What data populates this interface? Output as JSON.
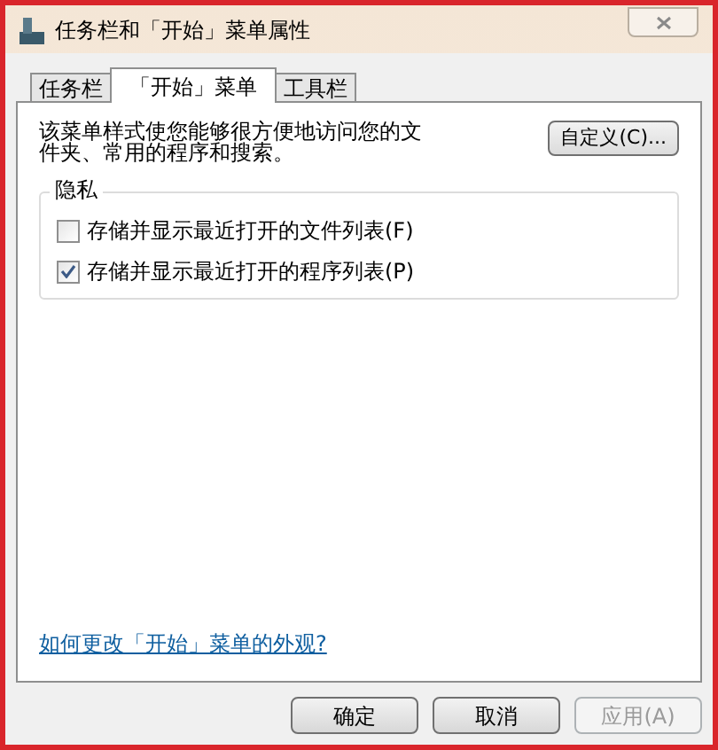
{
  "window": {
    "title": "任务栏和「开始」菜单属性"
  },
  "tabs": [
    {
      "label": "任务栏",
      "selected": false
    },
    {
      "label": "「开始」菜单",
      "selected": true
    },
    {
      "label": "工具栏",
      "selected": false
    }
  ],
  "description": "该菜单样式使您能够很方便地访问您的文件夹、常用的程序和搜索。",
  "customize_button": "自定义(C)...",
  "privacy": {
    "title": "隐私",
    "options": [
      {
        "label": "存储并显示最近打开的文件列表(F)",
        "checked": false
      },
      {
        "label": "存储并显示最近打开的程序列表(P)",
        "checked": true
      }
    ]
  },
  "help_link": "如何更改「开始」菜单的外观?",
  "buttons": [
    {
      "label": "确定",
      "disabled": false
    },
    {
      "label": "取消",
      "disabled": false
    },
    {
      "label": "应用(A)",
      "disabled": true
    }
  ]
}
